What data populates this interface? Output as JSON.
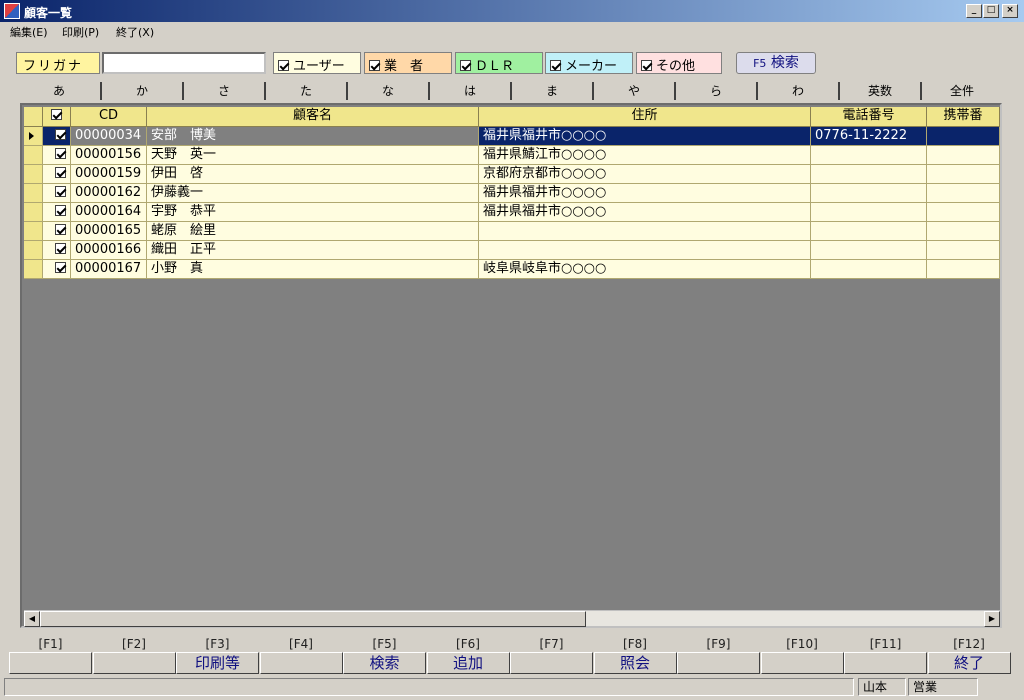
{
  "window": {
    "title": "顧客一覧",
    "min": "_",
    "max": "□",
    "close": "×"
  },
  "menu": [
    "編集(E)",
    "印刷(P)",
    "終了(X)"
  ],
  "filter": {
    "furigana_label": "フリガナ",
    "furigana_value": "",
    "checks": [
      {
        "label": "ユーザー",
        "color": "#fffde0"
      },
      {
        "label": "業　者",
        "color": "#ffd8a8"
      },
      {
        "label": "ＤＬＲ",
        "color": "#a0f0a0"
      },
      {
        "label": "メーカー",
        "color": "#c0f0f8"
      },
      {
        "label": "その他",
        "color": "#ffe0e0"
      }
    ],
    "search_key": "F5",
    "search_label": "検索"
  },
  "kana_tabs": [
    "あ",
    "か",
    "さ",
    "た",
    "な",
    "は",
    "ま",
    "や",
    "ら",
    "わ",
    "英数",
    "全件"
  ],
  "grid": {
    "columns": [
      "CD",
      "顧客名",
      "住所",
      "電話番号",
      "携帯番"
    ],
    "rows": [
      {
        "cd": "00000034",
        "name": "安部　博美",
        "address": "福井県福井市○○○○",
        "phone": "0776-11-2222",
        "mobile": ""
      },
      {
        "cd": "00000156",
        "name": "天野　英一",
        "address": "福井県鯖江市○○○○",
        "phone": "",
        "mobile": ""
      },
      {
        "cd": "00000159",
        "name": "伊田　啓",
        "address": "京都府京都市○○○○",
        "phone": "",
        "mobile": ""
      },
      {
        "cd": "00000162",
        "name": "伊藤義一",
        "address": "福井県福井市○○○○",
        "phone": "",
        "mobile": ""
      },
      {
        "cd": "00000164",
        "name": "宇野　恭平",
        "address": "福井県福井市○○○○",
        "phone": "",
        "mobile": ""
      },
      {
        "cd": "00000165",
        "name": "蛯原　絵里",
        "address": "",
        "phone": "",
        "mobile": ""
      },
      {
        "cd": "00000166",
        "name": "織田　正平",
        "address": "",
        "phone": "",
        "mobile": ""
      },
      {
        "cd": "00000167",
        "name": "小野　真",
        "address": "岐阜県岐阜市○○○○",
        "phone": "",
        "mobile": ""
      }
    ]
  },
  "fkeys": [
    {
      "key": "[F1]",
      "label": ""
    },
    {
      "key": "[F2]",
      "label": ""
    },
    {
      "key": "[F3]",
      "label": "印刷等"
    },
    {
      "key": "[F4]",
      "label": ""
    },
    {
      "key": "[F5]",
      "label": "検索"
    },
    {
      "key": "[F6]",
      "label": "追加"
    },
    {
      "key": "[F7]",
      "label": ""
    },
    {
      "key": "[F8]",
      "label": "照会"
    },
    {
      "key": "[F9]",
      "label": ""
    },
    {
      "key": "[F10]",
      "label": ""
    },
    {
      "key": "[F11]",
      "label": ""
    },
    {
      "key": "[F12]",
      "label": "終了"
    }
  ],
  "status": {
    "user": "山本",
    "dept": "営業"
  }
}
